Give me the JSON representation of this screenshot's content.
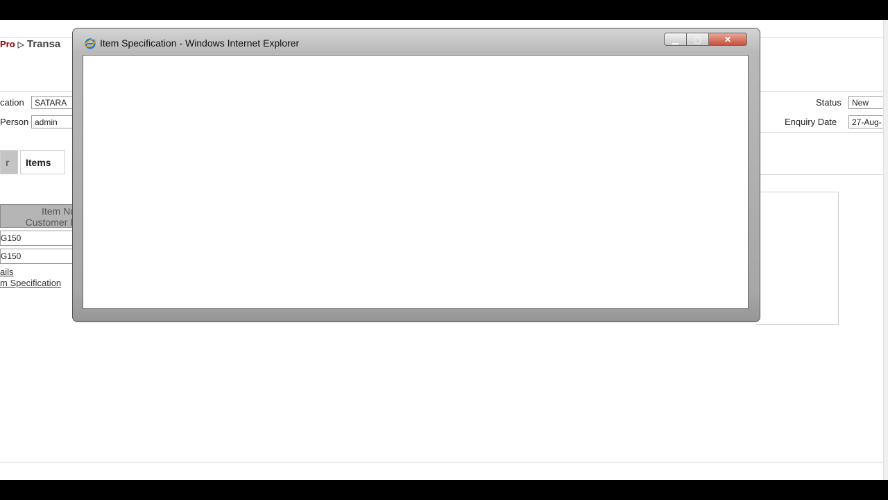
{
  "app": {
    "breadcrumb_brand": "Pro",
    "breadcrumb_item": "Transa",
    "location_label": "cation",
    "location_value": "SATARA",
    "person_label": "Person",
    "person_value": "admin",
    "status_label": "Status",
    "status_value": "New",
    "enquiry_date_label": "Enquiry Date",
    "enquiry_date_value": "27-Aug-",
    "tabs": {
      "prev_label": "r",
      "items_label": "Items"
    },
    "grid": {
      "header_line1": "Item Nu",
      "header_line2": "Customer It",
      "rows": [
        "G150",
        "G150"
      ]
    },
    "links": {
      "details": "ails",
      "item_spec": "m Specification"
    }
  },
  "popup": {
    "title": "Item Specification - Windows Internet Explorer",
    "icon": "internet-explorer-icon",
    "min_glyph": "▁",
    "max_glyph": "▢",
    "close_glyph": "✕"
  }
}
